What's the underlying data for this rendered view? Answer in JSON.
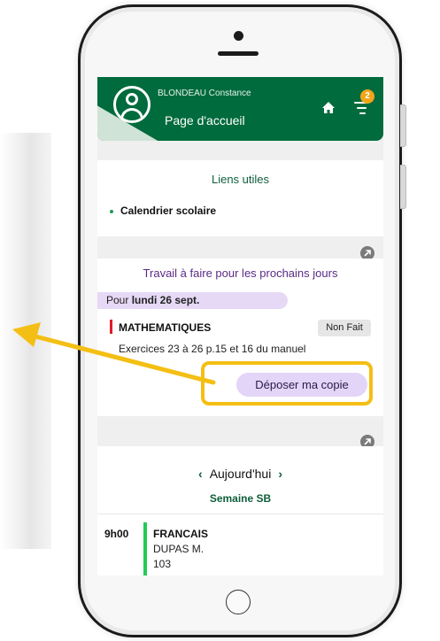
{
  "header": {
    "user_name": "BLONDEAU Constance",
    "page_title": "Page d'accueil",
    "notification_count": "2"
  },
  "useful_links": {
    "title": "Liens utiles",
    "items": [
      {
        "label": "Calendrier scolaire"
      }
    ]
  },
  "homework": {
    "title": "Travail à faire pour les prochains jours",
    "date_prefix": "Pour ",
    "date_label": "lundi 26 sept.",
    "subject": "MATHEMATIQUES",
    "status": "Non Fait",
    "description": "Exercices 23 à 26 p.15 et 16 du manuel",
    "submit_label": "Déposer ma copie"
  },
  "schedule": {
    "nav_label": "Aujourd'hui",
    "prev_symbol": "‹",
    "next_symbol": "›",
    "week_label": "Semaine SB",
    "lessons": [
      {
        "time": "9h00",
        "subject": "FRANCAIS",
        "teacher": "DUPAS M.",
        "room": "103"
      }
    ]
  },
  "colors": {
    "header_green": "#006b3c",
    "accent_purple": "#5b2a86",
    "highlight_yellow": "#f4bf14",
    "badge_orange": "#f2a51a",
    "lesson_green": "#22cc55",
    "subject_red": "#e21b2c"
  },
  "icons": [
    "avatar-icon",
    "home-icon",
    "menu-icon",
    "open-section-icon",
    "prev-icon",
    "next-icon"
  ]
}
